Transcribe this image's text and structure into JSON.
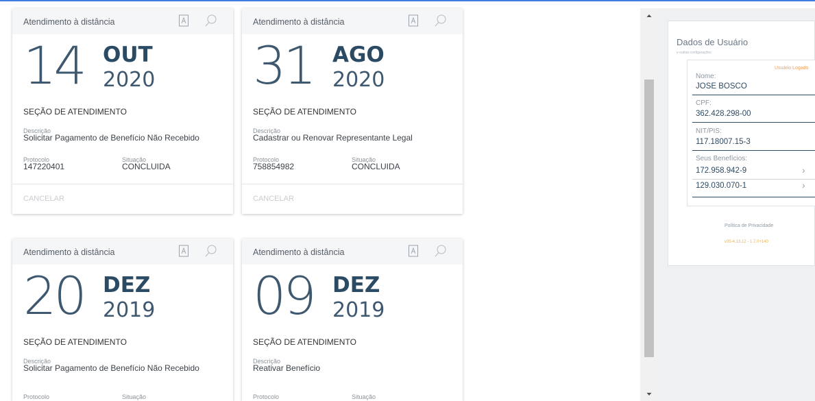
{
  "cards": [
    {
      "header": "Atendimento à distância",
      "day": "14",
      "month": "OUT",
      "year": "2020",
      "section": "SEÇÃO DE ATENDIMENTO",
      "description_label": "Descrição",
      "description": "Solicitar Pagamento de Benefício Não Recebido",
      "protocol_label": "Protocolo",
      "protocol": "147220401",
      "status_label": "Situação",
      "status": "CONCLUIDA",
      "cancel": "CANCELAR"
    },
    {
      "header": "Atendimento à distância",
      "day": "31",
      "month": "AGO",
      "year": "2020",
      "section": "SEÇÃO DE ATENDIMENTO",
      "description_label": "Descrição",
      "description": "Cadastrar ou Renovar Representante Legal",
      "protocol_label": "Protocolo",
      "protocol": "758854982",
      "status_label": "Situação",
      "status": "CONCLUIDA",
      "cancel": "CANCELAR"
    },
    {
      "header": "Atendimento à distância",
      "day": "20",
      "month": "DEZ",
      "year": "2019",
      "section": "SEÇÃO DE ATENDIMENTO",
      "description_label": "Descrição",
      "description": "Solicitar Pagamento de Benefício Não Recebido",
      "protocol_label": "Protocolo",
      "protocol": "",
      "status_label": "Situação",
      "status": ""
    },
    {
      "header": "Atendimento à distância",
      "day": "09",
      "month": "DEZ",
      "year": "2019",
      "section": "SEÇÃO DE ATENDIMENTO",
      "description_label": "Descrição",
      "description": "Reativar Benefício",
      "protocol_label": "Protocolo",
      "protocol": "",
      "status_label": "Situação",
      "status": ""
    }
  ],
  "user_panel": {
    "title": "Dados de Usuário",
    "subtitle": "e outras configurações",
    "logged_badge": "Usuário Logado",
    "name_label": "Nome:",
    "name": "JOSE BOSCO",
    "cpf_label": "CPF:",
    "cpf": "362.428.298-00",
    "nit_label": "NIT/PIS:",
    "nit": "117.18007.15-3",
    "benefits_label": "Seus Benefícios:",
    "benefits": [
      "172.958.942-9",
      "129.030.070-1"
    ],
    "privacy": "Política de Privacidade",
    "version": "v35-4.13.12 - 1.7.0+140"
  },
  "icons": {
    "pdf": "pdf-icon",
    "search": "search-icon",
    "chevron": "chevron-right-icon"
  },
  "colors": {
    "accent": "#3d7ee0",
    "badge": "#f1a25b"
  }
}
